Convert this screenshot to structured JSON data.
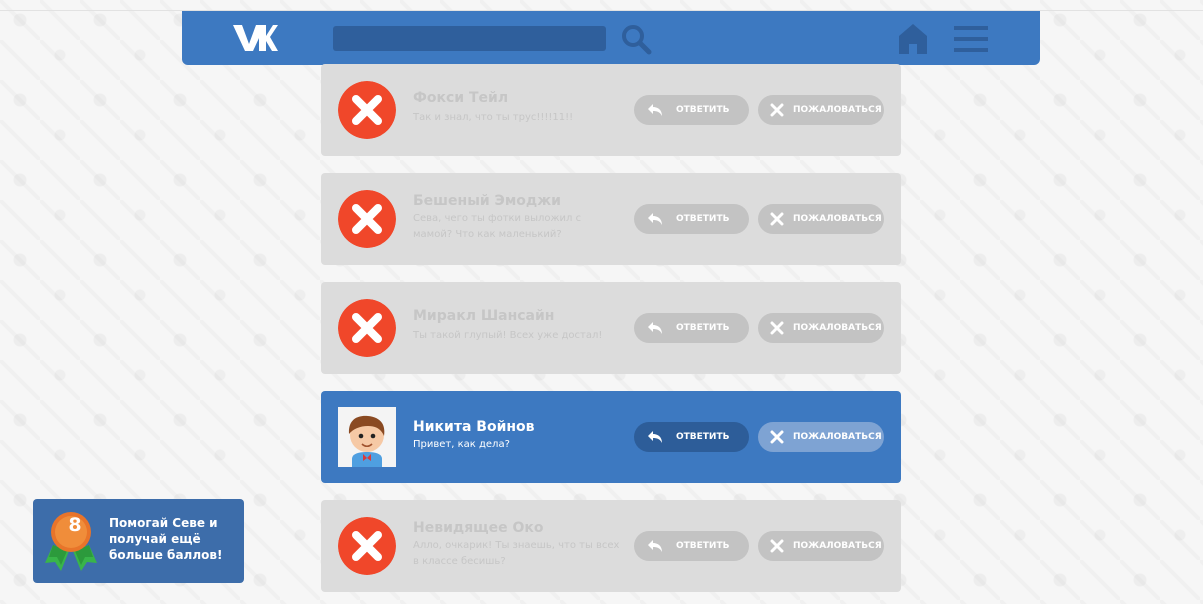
{
  "header": {
    "logo": "VK",
    "search": {
      "value": "",
      "placeholder": ""
    }
  },
  "colors": {
    "header": "#3d79c1",
    "card": "#dcdcdc",
    "active_card": "#3d79c1",
    "blocked_avatar": "#f0472a",
    "button": "#c3c3c3"
  },
  "icons": [
    "vk-logo",
    "search-icon",
    "home-icon",
    "menu-icon",
    "reply-arrow-icon",
    "close-x-icon",
    "medal-icon"
  ],
  "messages": [
    {
      "name": "Фокси Тейл",
      "text": "Так и знал, что ты трус!!!!11!!",
      "reply": "ОТВЕТИТЬ",
      "report": "ПОЖАЛОВАТЬСЯ",
      "state": "blocked"
    },
    {
      "name": "Бешеный Эмоджи",
      "text": "Сева, чего ты фотки выложил с мамой? Что как маленький?",
      "reply": "ОТВЕТИТЬ",
      "report": "ПОЖАЛОВАТЬСЯ",
      "state": "blocked"
    },
    {
      "name": "Миракл Шансайн",
      "text": "Ты такой глупый! Всех уже достал!",
      "reply": "ОТВЕТИТЬ",
      "report": "ПОЖАЛОВАТЬСЯ",
      "state": "blocked"
    },
    {
      "name": "Никита Войнов",
      "text": "Привет, как дела?",
      "reply": "ОТВЕТИТЬ",
      "report": "ПОЖАЛОВАТЬСЯ",
      "state": "active"
    },
    {
      "name": "Невидящее Око",
      "text": "Алло, очкарик! Ты знаешь, что ты всех в классе бесишь?",
      "reply": "ОТВЕТИТЬ",
      "report": "ПОЖАЛОВАТЬСЯ",
      "state": "blocked"
    }
  ],
  "promo": {
    "score": "8",
    "text": "Помогай Севе и получай ещё больше баллов!"
  }
}
